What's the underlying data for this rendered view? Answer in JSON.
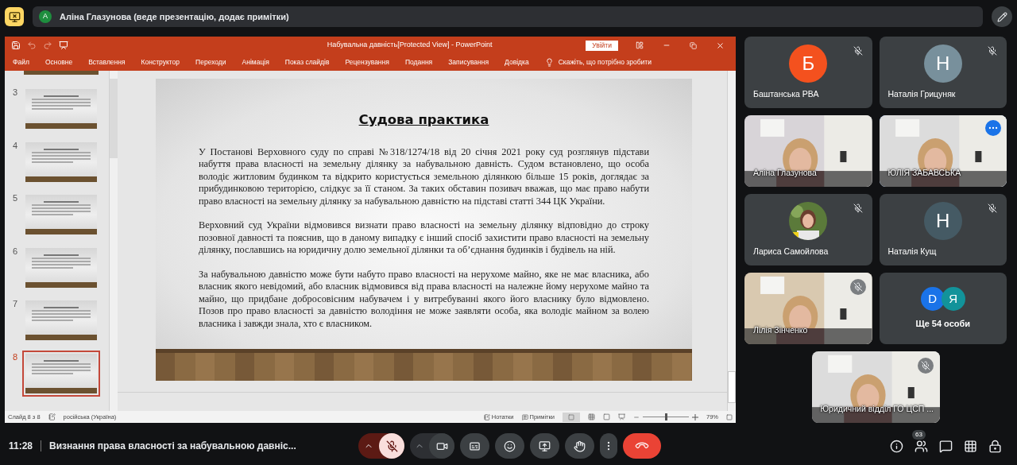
{
  "top_bar": {
    "presenter_letter": "А",
    "presenter_text": "Аліна Глазунова (веде презентацію, додає примітки)"
  },
  "powerpoint": {
    "title": "Набувальна давність[Protected View] - PowerPoint",
    "signin": "Увійти",
    "ribbon": [
      "Файл",
      "Основне",
      "Вставлення",
      "Конструктор",
      "Переходи",
      "Анімація",
      "Показ слайдів",
      "Рецензування",
      "Подання",
      "Записування",
      "Довідка"
    ],
    "tell_me": "Скажіть, що потрібно зробити",
    "thumbnails": [
      {
        "number": "3",
        "selected": false
      },
      {
        "number": "4",
        "selected": false
      },
      {
        "number": "5",
        "selected": false
      },
      {
        "number": "6",
        "selected": false
      },
      {
        "number": "7",
        "selected": false
      },
      {
        "number": "8",
        "selected": true
      }
    ],
    "slide": {
      "title": "Судова практика",
      "paragraphs": [
        "У Постанові Верховного суду по справі №318/1274/18 від 20 січня 2021 року суд розглянув підстави набуття права власності на земельну ділянку за набувальною давність. Судом встановлено, що особа володіє житловим будинком та відкрито користується земельною ділянкою більше 15 років, доглядає за прибудинковою територією, слідкує за її станом. За таких обставин позивач вважав, що має право набути право власності на земельну ділянку за набувальною давністю на підставі статті 344 ЦК України.",
        "Верховний суд України відмовився визнати право власності на земельну ділянку відповідно до строку позовної давності та пояснив, що в даному випадку є інший спосіб захистити право власності на земельну ділянку, пославшись на юридичну долю земельної ділянки та об’єднання будинків і будівель на ній.",
        "За набувальною давністю може бути набуто право власності на нерухоме майно, яке не має власника, або власник якого невідомий, або власник відмовився від права власності на належне йому нерухоме майно та майно, що придбане добросовісним набувачем і у витребуванні якого його власнику було відмовлено. Позов про право власності за давністю володіння не може заявляти особа, яка володіє майном за волею власника і завжди знала, хто є власником."
      ]
    },
    "status": {
      "slide": "Слайд 8 з 8",
      "language": "російська (Україна)",
      "notes": "Нотатки",
      "comments": "Примітки",
      "zoom": {
        "level": 0.48
      },
      "zoom_text": "79%"
    }
  },
  "participants": [
    {
      "kind": "avatar",
      "name": "Баштанська РВА",
      "letter": "Б",
      "color": "#f4511e",
      "muted": true,
      "speaking": false
    },
    {
      "kind": "avatar",
      "name": "Наталія Грицуняк",
      "letter": "Н",
      "color": "#78909c",
      "muted": true,
      "speaking": false
    },
    {
      "kind": "video",
      "name": "Аліна Глазунова",
      "muted": false,
      "speaking": false
    },
    {
      "kind": "video",
      "name": "ЮЛІЯ ЗАБАВСЬКА",
      "muted": false,
      "speaking": true
    },
    {
      "name": "Лариса Самойлова",
      "muted": true,
      "speaking": false
    },
    {
      "kind": "avatar",
      "name": "Наталія Кущ",
      "letter": "Н",
      "color": "#455a64",
      "muted": true,
      "speaking": false
    },
    {
      "kind": "video",
      "name": "Лілія Зінченко",
      "muted": true,
      "speaking": false
    },
    {
      "kind": "more",
      "label": "Ще 54 особи",
      "avatars": [
        {
          "letter": "D",
          "color": "#1a73e8"
        },
        {
          "letter": "Я",
          "color": "#12939a"
        }
      ]
    },
    {
      "kind": "video",
      "name": "Юридичний відділ ГО ЦСП ...",
      "muted": true,
      "speaking": false
    }
  ],
  "bottom_bar": {
    "time": "11:28",
    "meeting_title": "Визнання права власності за набувальною давніс...",
    "mic_muted": true,
    "people_count": "63"
  }
}
